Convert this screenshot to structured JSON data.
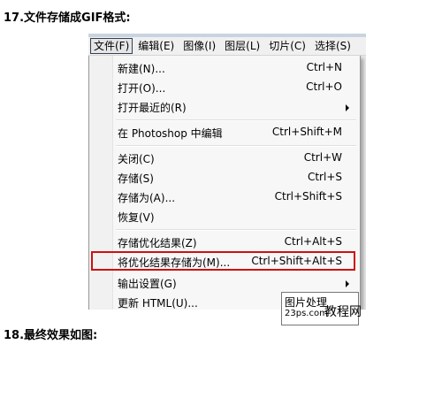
{
  "headings": {
    "step17": "17.文件存储成GIF格式:",
    "step18": "18.最终效果如图:"
  },
  "menubar": [
    {
      "label": "文件(F)",
      "active": true
    },
    {
      "label": "编辑(E)"
    },
    {
      "label": "图像(I)"
    },
    {
      "label": "图层(L)"
    },
    {
      "label": "切片(C)"
    },
    {
      "label": "选择(S)"
    }
  ],
  "file_menu": {
    "items": [
      {
        "label": "新建(N)...",
        "shortcut": "Ctrl+N"
      },
      {
        "label": "打开(O)...",
        "shortcut": "Ctrl+O"
      },
      {
        "label": "打开最近的(R)",
        "shortcut": "",
        "submenu": true
      },
      {
        "label": "在 Photoshop 中编辑",
        "shortcut": "Ctrl+Shift+M"
      },
      {
        "label": "关闭(C)",
        "shortcut": "Ctrl+W"
      },
      {
        "label": "存储(S)",
        "shortcut": "Ctrl+S"
      },
      {
        "label": "存储为(A)...",
        "shortcut": "Ctrl+Shift+S"
      },
      {
        "label": "恢复(V)",
        "shortcut": ""
      },
      {
        "label": "存储优化结果(Z)",
        "shortcut": "Ctrl+Alt+S"
      },
      {
        "label": "将优化结果存储为(M)...",
        "shortcut": "Ctrl+Shift+Alt+S",
        "highlighted": true
      },
      {
        "label": "输出设置(G)",
        "shortcut": "",
        "submenu": true
      },
      {
        "label": "更新 HTML(U)...",
        "shortcut": ""
      }
    ]
  },
  "watermark": {
    "line1": "图片处理",
    "line2": "23ps.com",
    "big": "教程网"
  },
  "colors": {
    "highlight_border": "#cc1111",
    "menu_background": "#f7f7f7",
    "menubar_background": "#f0f0f0"
  }
}
